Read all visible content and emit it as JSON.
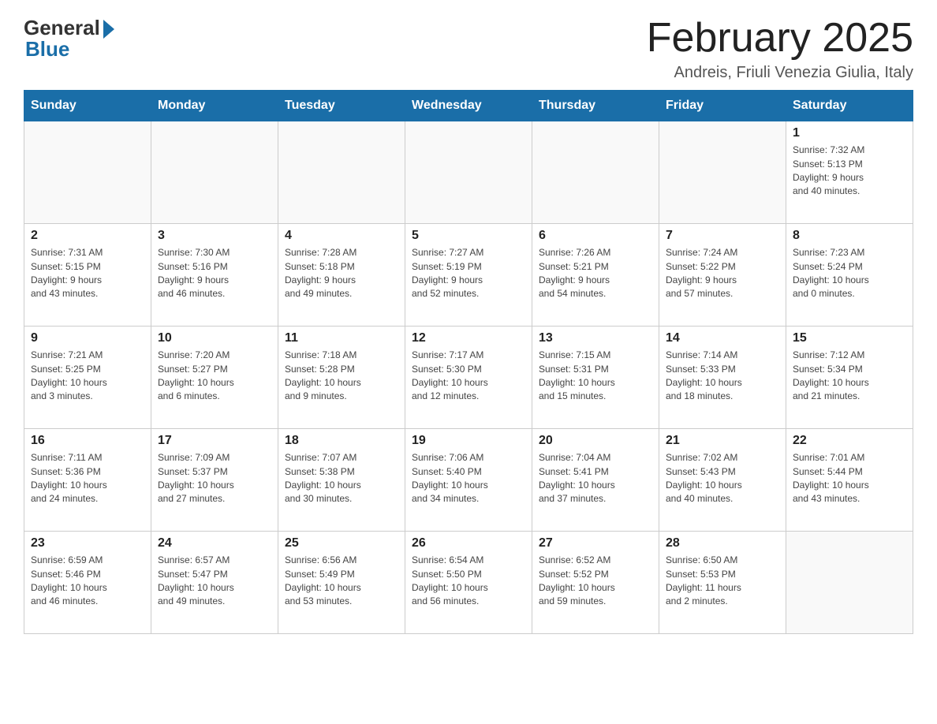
{
  "logo": {
    "general": "General",
    "blue": "Blue"
  },
  "title": "February 2025",
  "subtitle": "Andreis, Friuli Venezia Giulia, Italy",
  "days_of_week": [
    "Sunday",
    "Monday",
    "Tuesday",
    "Wednesday",
    "Thursday",
    "Friday",
    "Saturday"
  ],
  "weeks": [
    [
      {
        "day": "",
        "info": ""
      },
      {
        "day": "",
        "info": ""
      },
      {
        "day": "",
        "info": ""
      },
      {
        "day": "",
        "info": ""
      },
      {
        "day": "",
        "info": ""
      },
      {
        "day": "",
        "info": ""
      },
      {
        "day": "1",
        "info": "Sunrise: 7:32 AM\nSunset: 5:13 PM\nDaylight: 9 hours\nand 40 minutes."
      }
    ],
    [
      {
        "day": "2",
        "info": "Sunrise: 7:31 AM\nSunset: 5:15 PM\nDaylight: 9 hours\nand 43 minutes."
      },
      {
        "day": "3",
        "info": "Sunrise: 7:30 AM\nSunset: 5:16 PM\nDaylight: 9 hours\nand 46 minutes."
      },
      {
        "day": "4",
        "info": "Sunrise: 7:28 AM\nSunset: 5:18 PM\nDaylight: 9 hours\nand 49 minutes."
      },
      {
        "day": "5",
        "info": "Sunrise: 7:27 AM\nSunset: 5:19 PM\nDaylight: 9 hours\nand 52 minutes."
      },
      {
        "day": "6",
        "info": "Sunrise: 7:26 AM\nSunset: 5:21 PM\nDaylight: 9 hours\nand 54 minutes."
      },
      {
        "day": "7",
        "info": "Sunrise: 7:24 AM\nSunset: 5:22 PM\nDaylight: 9 hours\nand 57 minutes."
      },
      {
        "day": "8",
        "info": "Sunrise: 7:23 AM\nSunset: 5:24 PM\nDaylight: 10 hours\nand 0 minutes."
      }
    ],
    [
      {
        "day": "9",
        "info": "Sunrise: 7:21 AM\nSunset: 5:25 PM\nDaylight: 10 hours\nand 3 minutes."
      },
      {
        "day": "10",
        "info": "Sunrise: 7:20 AM\nSunset: 5:27 PM\nDaylight: 10 hours\nand 6 minutes."
      },
      {
        "day": "11",
        "info": "Sunrise: 7:18 AM\nSunset: 5:28 PM\nDaylight: 10 hours\nand 9 minutes."
      },
      {
        "day": "12",
        "info": "Sunrise: 7:17 AM\nSunset: 5:30 PM\nDaylight: 10 hours\nand 12 minutes."
      },
      {
        "day": "13",
        "info": "Sunrise: 7:15 AM\nSunset: 5:31 PM\nDaylight: 10 hours\nand 15 minutes."
      },
      {
        "day": "14",
        "info": "Sunrise: 7:14 AM\nSunset: 5:33 PM\nDaylight: 10 hours\nand 18 minutes."
      },
      {
        "day": "15",
        "info": "Sunrise: 7:12 AM\nSunset: 5:34 PM\nDaylight: 10 hours\nand 21 minutes."
      }
    ],
    [
      {
        "day": "16",
        "info": "Sunrise: 7:11 AM\nSunset: 5:36 PM\nDaylight: 10 hours\nand 24 minutes."
      },
      {
        "day": "17",
        "info": "Sunrise: 7:09 AM\nSunset: 5:37 PM\nDaylight: 10 hours\nand 27 minutes."
      },
      {
        "day": "18",
        "info": "Sunrise: 7:07 AM\nSunset: 5:38 PM\nDaylight: 10 hours\nand 30 minutes."
      },
      {
        "day": "19",
        "info": "Sunrise: 7:06 AM\nSunset: 5:40 PM\nDaylight: 10 hours\nand 34 minutes."
      },
      {
        "day": "20",
        "info": "Sunrise: 7:04 AM\nSunset: 5:41 PM\nDaylight: 10 hours\nand 37 minutes."
      },
      {
        "day": "21",
        "info": "Sunrise: 7:02 AM\nSunset: 5:43 PM\nDaylight: 10 hours\nand 40 minutes."
      },
      {
        "day": "22",
        "info": "Sunrise: 7:01 AM\nSunset: 5:44 PM\nDaylight: 10 hours\nand 43 minutes."
      }
    ],
    [
      {
        "day": "23",
        "info": "Sunrise: 6:59 AM\nSunset: 5:46 PM\nDaylight: 10 hours\nand 46 minutes."
      },
      {
        "day": "24",
        "info": "Sunrise: 6:57 AM\nSunset: 5:47 PM\nDaylight: 10 hours\nand 49 minutes."
      },
      {
        "day": "25",
        "info": "Sunrise: 6:56 AM\nSunset: 5:49 PM\nDaylight: 10 hours\nand 53 minutes."
      },
      {
        "day": "26",
        "info": "Sunrise: 6:54 AM\nSunset: 5:50 PM\nDaylight: 10 hours\nand 56 minutes."
      },
      {
        "day": "27",
        "info": "Sunrise: 6:52 AM\nSunset: 5:52 PM\nDaylight: 10 hours\nand 59 minutes."
      },
      {
        "day": "28",
        "info": "Sunrise: 6:50 AM\nSunset: 5:53 PM\nDaylight: 11 hours\nand 2 minutes."
      },
      {
        "day": "",
        "info": ""
      }
    ]
  ]
}
